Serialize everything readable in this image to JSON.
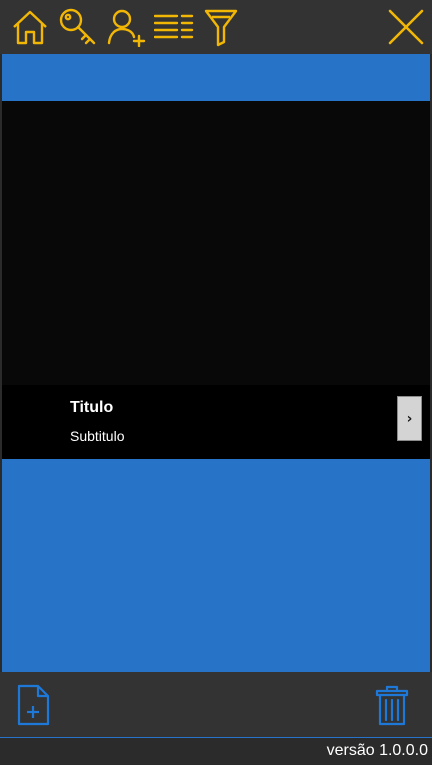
{
  "toolbar": {
    "icons": [
      "home-icon",
      "key-icon",
      "add-user-icon",
      "list-icon",
      "filter-icon",
      "close-icon"
    ],
    "accent_color": "#f2b705"
  },
  "main": {
    "background_color": "#2673c7"
  },
  "card": {
    "title": "Titulo",
    "subtitle": "Subtitulo",
    "next_label": "›"
  },
  "bottom_toolbar": {
    "icons": [
      "new-file-icon",
      "trash-icon"
    ],
    "icon_color": "#1e78d8"
  },
  "footer": {
    "version": "versão 1.0.0.0"
  }
}
